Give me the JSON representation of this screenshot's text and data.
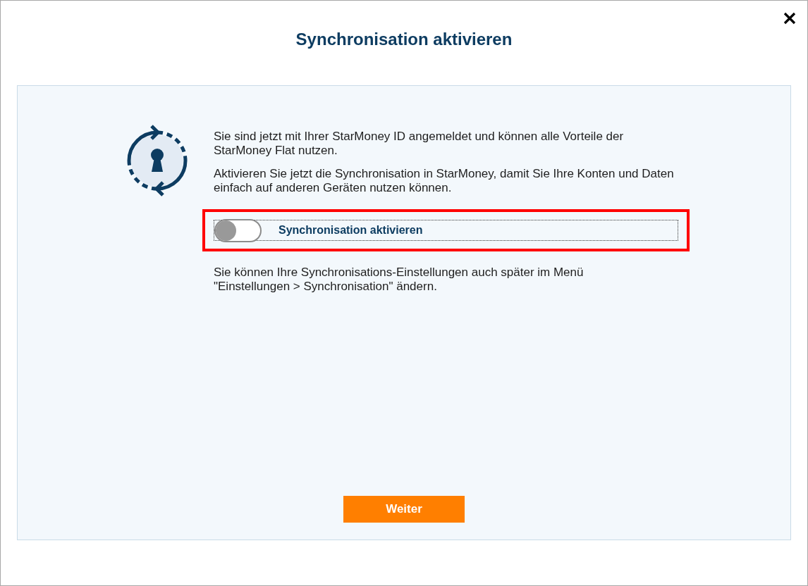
{
  "dialog": {
    "title": "Synchronisation aktivieren"
  },
  "intro": [
    "Sie sind jetzt mit Ihrer StarMoney ID angemeldet und können alle Vorteile der StarMoney Flat nutzen.",
    "Aktivieren Sie jetzt die Synchronisation in StarMoney, damit Sie Ihre Konten und Daten einfach auf anderen Geräten nutzen können."
  ],
  "sync_toggle": {
    "label": "Synchronisation aktivieren",
    "on": false,
    "focused": true,
    "highlighted": true
  },
  "note": "Sie können Ihre Synchronisations-Einstellungen auch später im Menü \"Einstellungen > Synchronisation\" ändern.",
  "buttons": [
    {
      "label": "Weiter"
    }
  ]
}
